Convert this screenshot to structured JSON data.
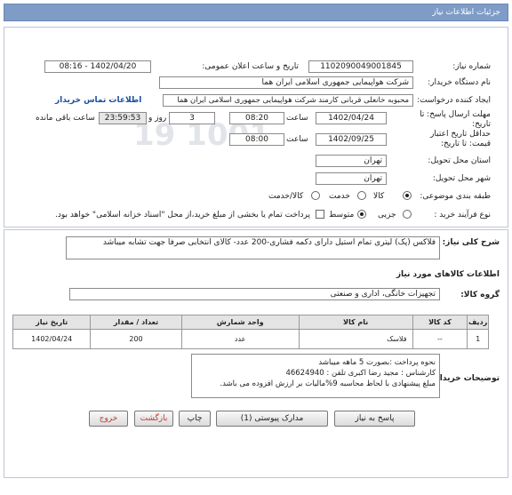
{
  "header": {
    "title": "جزئیات اطلاعات نیاز"
  },
  "need": {
    "number_label": "شماره نیاز:",
    "number_value": "1102090049001845",
    "announce_label": "تاریخ و ساعت اعلان عمومی:",
    "announce_value": "1402/04/20 - 08:16",
    "buyer_label": "نام دستگاه خریدار:",
    "buyer_value": "شرکت هواپیمایی جمهوری اسلامی ایران هما",
    "creator_label": "ایجاد کننده درخواست:",
    "creator_value": "محبوبه خانعلی قربانی کارمند شرکت هواپیمایی جمهوری اسلامی ایران هما",
    "contact_link": "اطلاعات تماس خریدار",
    "deadline_label": "مهلت ارسال پاسخ: تا تاریخ:",
    "deadline_date": "1402/04/24",
    "time_label": "ساعت",
    "deadline_time": "08:20",
    "days_value": "3",
    "days_label": "روز و",
    "remaining_value": "23:59:53",
    "remaining_label": "ساعت باقی مانده",
    "validity_label": "حداقل تاریخ اعتبار قیمت: تا تاریخ:",
    "validity_date": "1402/09/25",
    "validity_time_label": "ساعت",
    "validity_time": "08:00",
    "province_label": "استان محل تحویل:",
    "province_value": "تهران",
    "city_label": "شهر محل تحویل:",
    "city_value": "تهران",
    "category_label": "طبقه بندی موضوعی:",
    "category_options": [
      "کالا",
      "خدمت",
      "کالا/خدمت"
    ],
    "process_label": "نوع فرآیند خرید :",
    "process_options": [
      "جزیی",
      "متوسط"
    ],
    "payment_note": "پرداخت تمام یا بخشی از مبلغ خرید،از محل \"اسناد خزانه اسلامی\" خواهد بود."
  },
  "summary": {
    "label": "شرح کلی نیاز:",
    "value": "فلاکس (پک) لیتری تمام استیل  دارای دکمه فشاری-200  عدد- کالای انتخابی صرفا جهت تشابه میباشد"
  },
  "goods": {
    "section_title": "اطلاعات کالاهای مورد نیاز",
    "group_label": "گروه کالا:",
    "group_value": "تجهیزات خانگی، اداری و صنعتی",
    "columns": [
      "ردیف",
      "کد کالا",
      "نام کالا",
      "واحد شمارش",
      "تعداد / مقدار",
      "تاریخ نیاز"
    ],
    "rows": [
      {
        "index": "1",
        "code": "--",
        "name": "فلاسک",
        "unit": "عدد",
        "qty": "200",
        "date": "1402/04/24"
      }
    ]
  },
  "buyer_notes": {
    "label": "توضیحات خریدار:",
    "lines": [
      "نحوه  پرداخت :بصورت 5 ماهه میباشد",
      "کارشناس : مجید رضا اکبری      تلفن  : 46624940",
      "مبلغ پیشنهادی با لحاظ محاسبه 9%مالیات بر ارزش افزوده می باشد."
    ]
  },
  "buttons": {
    "reply": "پاسخ به نیاز",
    "docs": "مدارک پیوستی (1)",
    "print": "چاپ",
    "back": "بازگشت",
    "exit": "خروج"
  },
  "watermark": {
    "site": "ParsNamadData.com",
    "phone": "۰۲۱-۸۸۳۴۹۶۷۰-۵"
  }
}
